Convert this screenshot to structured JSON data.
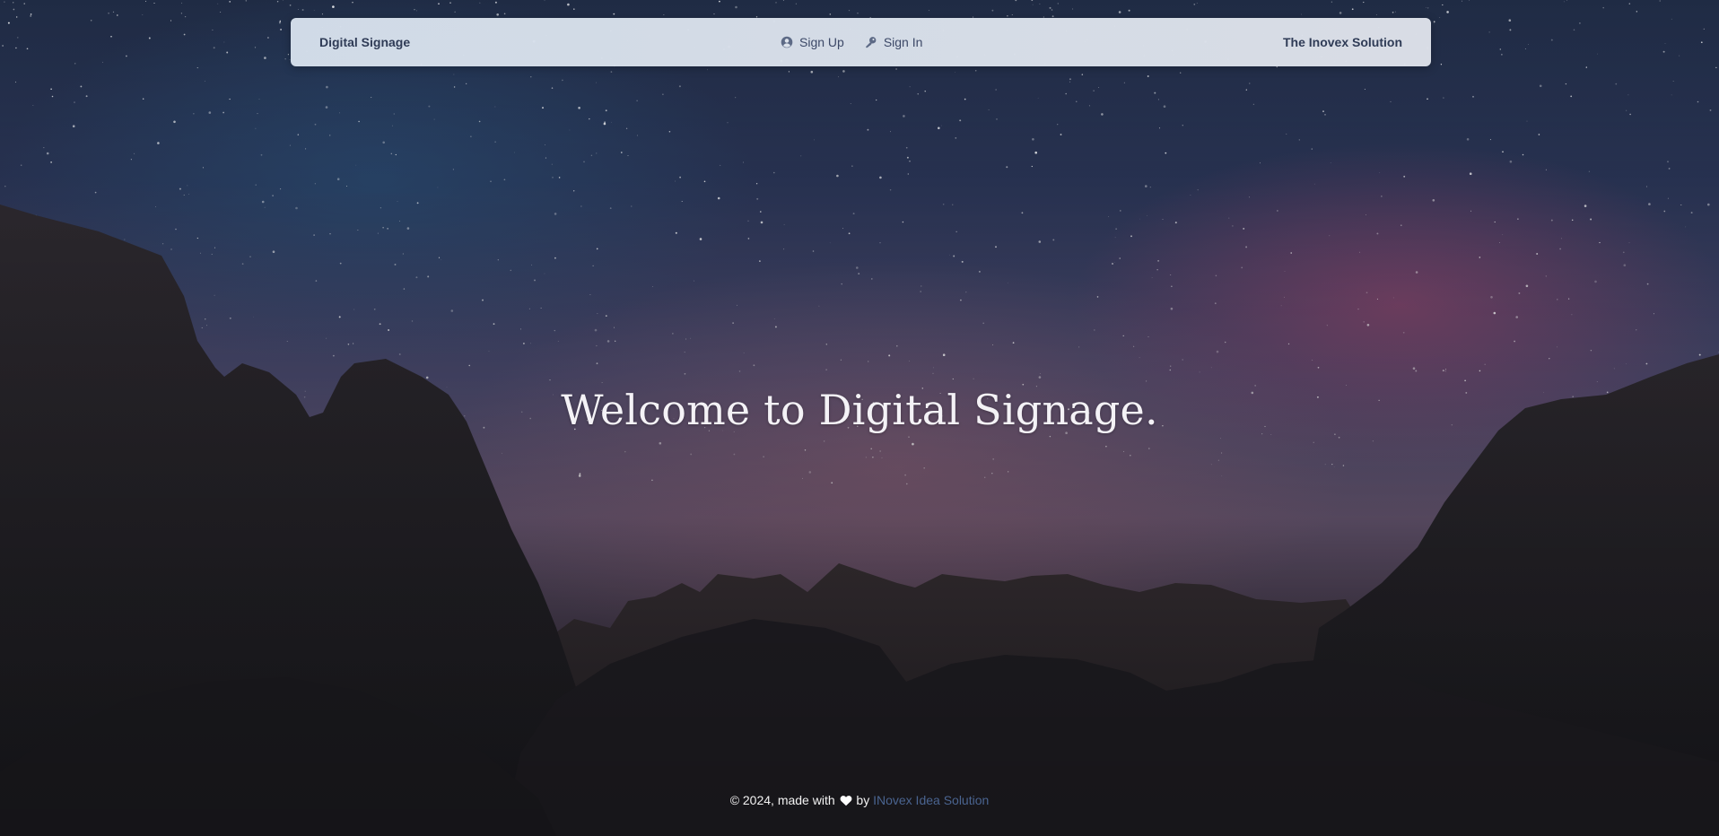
{
  "navbar": {
    "brand": "Digital Signage",
    "links": [
      {
        "label": "Sign Up",
        "icon": "user-circle-icon"
      },
      {
        "label": "Sign In",
        "icon": "key-icon"
      }
    ],
    "right_text": "The Inovex Solution"
  },
  "hero": {
    "title": "Welcome to Digital Signage."
  },
  "footer": {
    "prefix": "© 2024, made with",
    "icon": "heart-icon",
    "by": "by",
    "link_text": "INovex Idea Solution"
  },
  "colors": {
    "navbar_bg": "#d6e0ec",
    "nav_text": "#2f3b56",
    "footer_link": "#4a6490",
    "title_text": "#f4f2f6"
  }
}
